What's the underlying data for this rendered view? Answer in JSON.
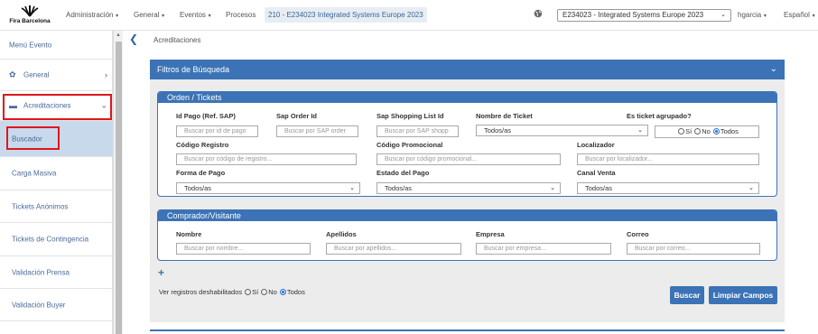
{
  "header": {
    "brand": "Fira Barcelona",
    "nav": [
      {
        "label": "Administración",
        "caret": true
      },
      {
        "label": "General",
        "caret": true
      },
      {
        "label": "Eventos",
        "caret": true
      },
      {
        "label": "Procesos",
        "caret": false
      }
    ],
    "event_chip": "210 - E234023 Integrated Systems Europe 2023",
    "event_select": "E234023 - Integrated Systems Europe 2023",
    "user": "hgarcia",
    "language": "Español"
  },
  "sidebar": {
    "title": "Menú Evento",
    "general": "General",
    "acreditaciones": "Acreditaciones",
    "items": [
      "Buscador",
      "Carga Masiva",
      "Tickets Anónimos",
      "Tickets de Contingencia",
      "Validación Prensa",
      "Validación Buyer"
    ]
  },
  "breadcrumb": "Acreditaciones",
  "panel": {
    "title": "Filtros de Búsqueda",
    "orden": {
      "title": "Orden / Tickets",
      "id_pago_label": "Id Pago (Ref. SAP)",
      "id_pago_ph": "Buscar por id de pago",
      "sap_order_label": "Sap Order Id",
      "sap_order_ph": "Buscar por SAP order",
      "sap_shopping_label": "Sap Shopping List Id",
      "sap_shopping_ph": "Buscar por SAP shopp",
      "nombre_ticket_label": "Nombre de Ticket",
      "nombre_ticket_value": "Todos/as",
      "agrupado_label": "Es ticket agrupado?",
      "agrupado_options": [
        "Sí",
        "No",
        "Todos"
      ],
      "codigo_registro_label": "Código Registro",
      "codigo_registro_ph": "Buscar por código de registro...",
      "codigo_promo_label": "Código Promocional",
      "codigo_promo_ph": "Buscar por código promocional...",
      "localizador_label": "Localizador",
      "localizador_ph": "Buscar por localizador...",
      "forma_pago_label": "Forma de Pago",
      "forma_pago_value": "Todos/as",
      "estado_pago_label": "Estado del Pago",
      "estado_pago_value": "Todos/as",
      "canal_venta_label": "Canal Venta",
      "canal_venta_value": "Todos/as"
    },
    "comprador": {
      "title": "Comprador/Visitante",
      "nombre_label": "Nombre",
      "nombre_ph": "Buscar por nombre...",
      "apellidos_label": "Apellidos",
      "apellidos_ph": "Buscar por apellidos...",
      "empresa_label": "Empresa",
      "empresa_ph": "Buscar por empresa...",
      "correo_label": "Correo",
      "correo_ph": "Buscar por correo..."
    },
    "deshabilitados_label": "Ver registros deshabilitados",
    "deshabilitados_options": [
      "Sí",
      "No",
      "Todos"
    ],
    "buscar": "Buscar",
    "limpiar": "Limpiar Campos"
  },
  "colors": {
    "accent": "#3b73b6",
    "highlight": "#e0161b",
    "active_bg": "#c9d9ec"
  }
}
